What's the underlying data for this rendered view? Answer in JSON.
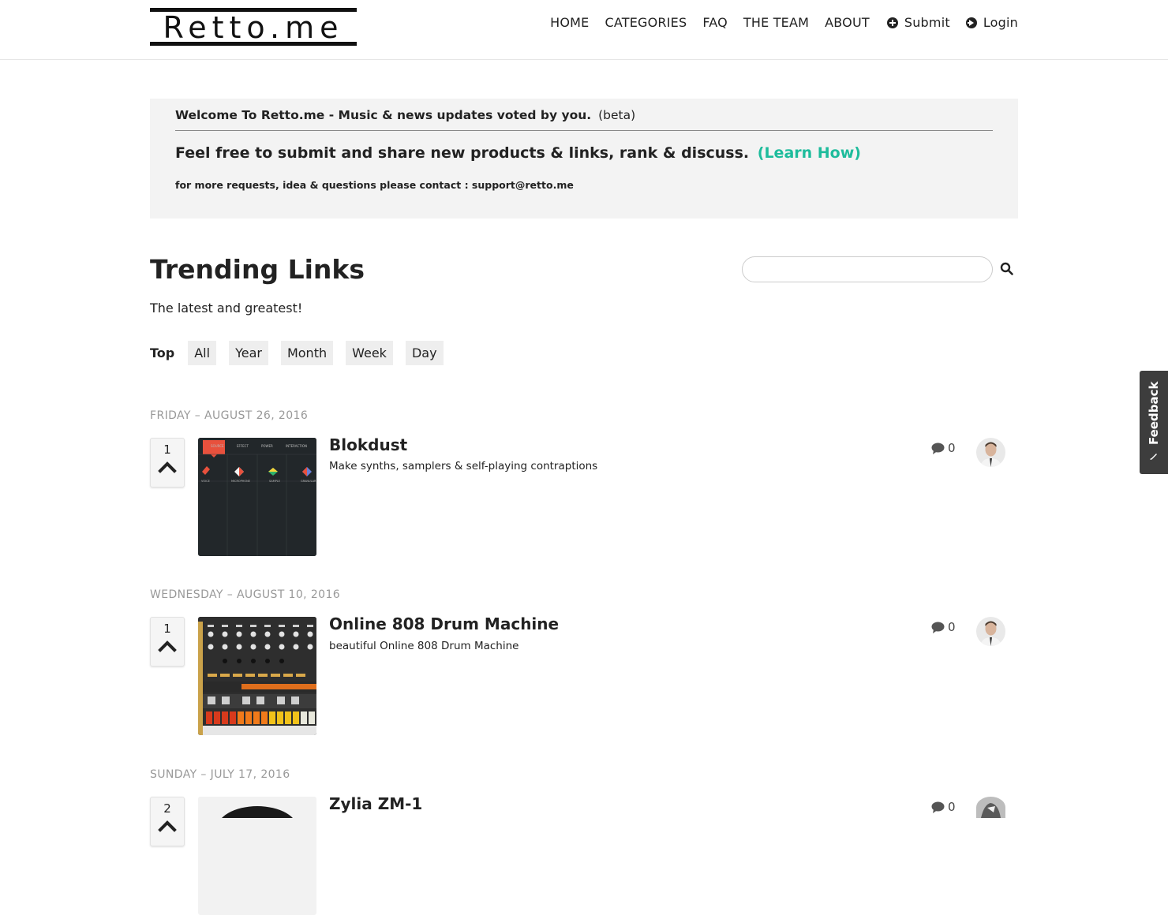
{
  "header": {
    "logo": "Retto.me",
    "nav": [
      "HOME",
      "CATEGORIES",
      "FAQ",
      "THE TEAM",
      "ABOUT"
    ],
    "submit_label": "Submit",
    "login_label": "Login"
  },
  "welcome": {
    "title": "Welcome To Retto.me - Music & news updates voted by you.",
    "beta": "(beta)",
    "tagline": "Feel free to submit and share new products & links, rank & discuss.",
    "learn_link": "(Learn How)",
    "contact": "for more requests, idea & questions please contact : support@retto.me"
  },
  "trending": {
    "title": "Trending Links",
    "subtitle": "The latest and greatest!",
    "search_placeholder": "",
    "filter_label": "Top",
    "filters": [
      "All",
      "Year",
      "Month",
      "Week",
      "Day"
    ]
  },
  "posts": [
    {
      "date": "FRIDAY – AUGUST 26, 2016",
      "votes": "1",
      "title": "Blokdust",
      "description": "Make synths, samplers & self-playing contraptions",
      "comments": "0"
    },
    {
      "date": "WEDNESDAY – AUGUST 10, 2016",
      "votes": "1",
      "title": "Online 808 Drum Machine",
      "description": "beautiful Online 808 Drum Machine",
      "comments": "0"
    },
    {
      "date": "SUNDAY – JULY 17, 2016",
      "votes": "2",
      "title": "Zylia ZM-1",
      "description": "",
      "comments": "0"
    }
  ],
  "feedback": {
    "label": "Feedback"
  },
  "colors": {
    "accent": "#1ebc9c",
    "panel": "#f3f3f3",
    "date": "#999999"
  },
  "icons": [
    "plus-circle-icon",
    "login-arrow-icon",
    "search-icon",
    "chevron-up-icon",
    "comment-icon",
    "feedback-icon"
  ]
}
